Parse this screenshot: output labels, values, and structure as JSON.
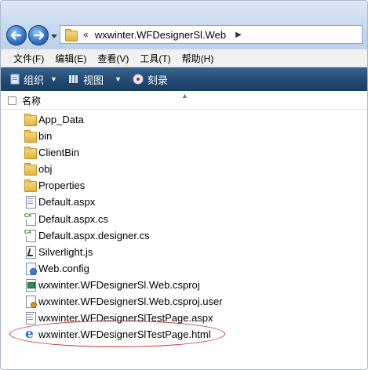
{
  "address_bar": {
    "separator": "«",
    "path": "wxwinter.WFDesignerSl.Web",
    "back_icon": "back-arrow-icon",
    "forward_icon": "forward-arrow-icon"
  },
  "menu": {
    "items": [
      {
        "label": "文件(F)"
      },
      {
        "label": "编辑(E)"
      },
      {
        "label": "查看(V)"
      },
      {
        "label": "工具(T)"
      },
      {
        "label": "帮助(H)"
      }
    ]
  },
  "toolbar": {
    "organize_label": "组织",
    "views_label": "视图",
    "burn_label": "刻录"
  },
  "column_header": {
    "name_label": "名称"
  },
  "files": [
    {
      "name": "App_Data",
      "icon": "folder-icon"
    },
    {
      "name": "bin",
      "icon": "folder-icon"
    },
    {
      "name": "ClientBin",
      "icon": "folder-icon"
    },
    {
      "name": "obj",
      "icon": "folder-icon"
    },
    {
      "name": "Properties",
      "icon": "folder-icon"
    },
    {
      "name": "Default.aspx",
      "icon": "aspx-file-icon"
    },
    {
      "name": "Default.aspx.cs",
      "icon": "csharp-file-icon"
    },
    {
      "name": "Default.aspx.designer.cs",
      "icon": "csharp-file-icon"
    },
    {
      "name": "Silverlight.js",
      "icon": "javascript-file-icon"
    },
    {
      "name": "Web.config",
      "icon": "config-file-icon"
    },
    {
      "name": "wxwinter.WFDesignerSl.Web.csproj",
      "icon": "csproj-file-icon"
    },
    {
      "name": "wxwinter.WFDesignerSl.Web.csproj.user",
      "icon": "csproj-user-file-icon"
    },
    {
      "name": "wxwinter.WFDesignerSlTestPage.aspx",
      "icon": "aspx-file-icon"
    },
    {
      "name": "wxwinter.WFDesignerSlTestPage.html",
      "icon": "ie-html-file-icon"
    }
  ],
  "colors": {
    "command_bar": "#224a73",
    "highlight_ellipse": "#c0312f",
    "folder": "#e2b33d"
  }
}
